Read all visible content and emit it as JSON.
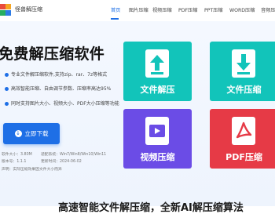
{
  "header": {
    "brand": "怪兽解压缩",
    "nav": [
      "首页",
      "图片压缩",
      "视频压缩",
      "PDF压缩",
      "PPT压缩",
      "WORD压缩",
      "音频压缩"
    ]
  },
  "hero": {
    "title": "免费解压缩软件",
    "features": [
      "专业文件解压缩软件,支持zip、rar、7z等格式",
      "高效智能压缩、自由调节参数、压缩率高达95%",
      "同时支持图片大小、视频大小、PDF大小压缩等功能"
    ],
    "download_label": "立即下载",
    "meta": {
      "size": "软件大小：3.80M",
      "system": "适配系统：Win7/Win8/Win10/Win11",
      "version": "版本号：1.1.1",
      "date": "更新时间：2024-06-02",
      "note": "声明：实际压缩效果因文件大小而异"
    }
  },
  "tiles": [
    {
      "label": "文件解压",
      "color": "#12c4ba",
      "icon": "upload-arrow-icon"
    },
    {
      "label": "文件压缩",
      "color": "#12c4ba",
      "icon": "download-arrow-icon"
    },
    {
      "label": "视频压缩",
      "color": "#6b4ce6",
      "icon": "video-icon"
    },
    {
      "label": "PDF压缩",
      "color": "#e63a46",
      "icon": "pdf-icon"
    }
  ],
  "bottom_title": "高速智能文件解压缩，全新AI解压缩算法"
}
